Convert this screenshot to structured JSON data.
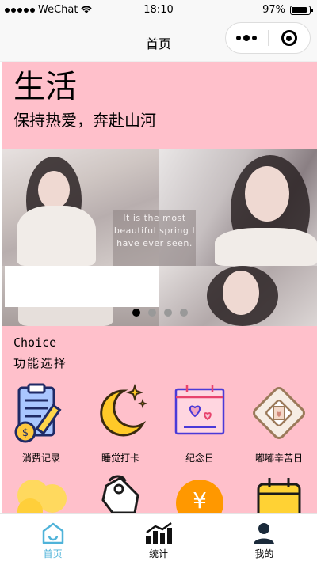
{
  "status_bar": {
    "carrier": "WeChat",
    "time": "18:10",
    "battery": "97%"
  },
  "nav": {
    "title": "首页"
  },
  "header": {
    "title": "生活",
    "subtitle": "保持热爱，奔赴山河"
  },
  "banner": {
    "quote": "It is the most beautiful spring I have ever seen.",
    "slide_count": 4,
    "active_slide": 1
  },
  "choice": {
    "title": "Choice",
    "subtitle": "功能选择",
    "items": [
      {
        "label": "消费记录",
        "icon": "clipboard-coin-icon"
      },
      {
        "label": "睡觉打卡",
        "icon": "moon-stars-icon"
      },
      {
        "label": "纪念日",
        "icon": "calendar-hearts-icon"
      },
      {
        "label": "嘟嘟辛苦日",
        "icon": "photo-frame-icon"
      },
      {
        "label": "",
        "icon": "coins-icon"
      },
      {
        "label": "",
        "icon": "price-tag-icon"
      },
      {
        "label": "",
        "icon": "yen-coin-icon"
      },
      {
        "label": "",
        "icon": "calendar-check-icon"
      }
    ]
  },
  "tabs": [
    {
      "label": "首页",
      "icon": "home-icon",
      "active": true
    },
    {
      "label": "统计",
      "icon": "bar-chart-icon",
      "active": false
    },
    {
      "label": "我的",
      "icon": "user-icon",
      "active": false
    }
  ],
  "colors": {
    "pink": "#ffc0cb",
    "active_tab": "#4fb3d9"
  }
}
